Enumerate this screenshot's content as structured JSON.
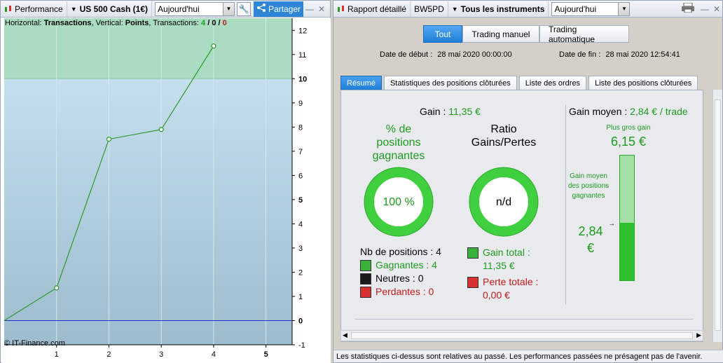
{
  "left": {
    "toolbar": {
      "title": "Performance",
      "instrument": "US 500 Cash (1€)",
      "period": "Aujourd'hui",
      "share": "Partager"
    },
    "chart_header": {
      "prefix": "Horizontal: ",
      "horizontal": "Transactions",
      "mid": ", Vertical: ",
      "vertical": "Points",
      "mid2": ", Transactions: ",
      "count_a": "4",
      "count_b": "0",
      "count_c": "0"
    },
    "watermark": "© IT-Finance.com"
  },
  "chart_data": {
    "type": "line",
    "x": [
      0,
      1,
      2,
      3,
      4
    ],
    "y": [
      0,
      1.35,
      7.5,
      7.9,
      11.35
    ],
    "xlim": [
      0,
      5.5
    ],
    "ylim": [
      -1,
      12.5
    ],
    "x_ticks": [
      "1",
      "2",
      "3",
      "4",
      "5"
    ],
    "y_ticks": [
      "-1",
      "0",
      "1",
      "2",
      "3",
      "4",
      "5",
      "6",
      "7",
      "8",
      "9",
      "10",
      "11",
      "12"
    ],
    "bold_ticks": [
      "5",
      "10",
      "0"
    ],
    "zone_upper_from": 10,
    "colors": {
      "line": "#2b9a2b",
      "zero_line": "#2233cc",
      "zone_upper": "#a9dcc0",
      "zone_lower": "#b9d6e6"
    }
  },
  "right": {
    "toolbar": {
      "title": "Rapport détaillé",
      "account": "BW5PD",
      "instruments": "Tous les instruments",
      "period": "Aujourd'hui"
    },
    "filters": [
      "Tout",
      "Trading manuel",
      "Trading automatique"
    ],
    "dates": {
      "start_label": "Date de début :",
      "start_value": "28 mai 2020 00:00:00",
      "end_label": "Date de fin :",
      "end_value": "28 mai 2020 12:54:41"
    },
    "tabs": [
      "Résumé",
      "Statistiques des positions clôturées",
      "Liste des ordres",
      "Liste des positions clôturées"
    ],
    "summary": {
      "gain_label": "Gain :",
      "gain_value": "11,35 €",
      "win_pct_title": "% de positions gagnantes",
      "win_pct_value": "100 %",
      "ratio_title": "Ratio Gains/Pertes",
      "ratio_value": "n/d",
      "nb_label": "Nb de positions : 4",
      "winning": "Gagnantes : 4",
      "neutral": "Neutres : 0",
      "losing": "Perdantes : 0",
      "gain_total_label": "Gain total :",
      "gain_total_value": "11,35 €",
      "loss_total_label": "Perte totale :",
      "loss_total_value": "0,00 €",
      "avg_gain_label": "Gain moyen :",
      "avg_gain_value": "2,84 € / trade",
      "best_gain_label": "Plus gros gain",
      "best_gain_value": "6,15 €",
      "avg_win_label": "Gain moyen des positions gagnantes",
      "avg_win_value": "2,84 €",
      "avg_win_fraction": 0.462
    },
    "status": "Les statistiques ci-dessus sont relatives au passé. Les performances passées ne présagent pas de l'avenir."
  }
}
